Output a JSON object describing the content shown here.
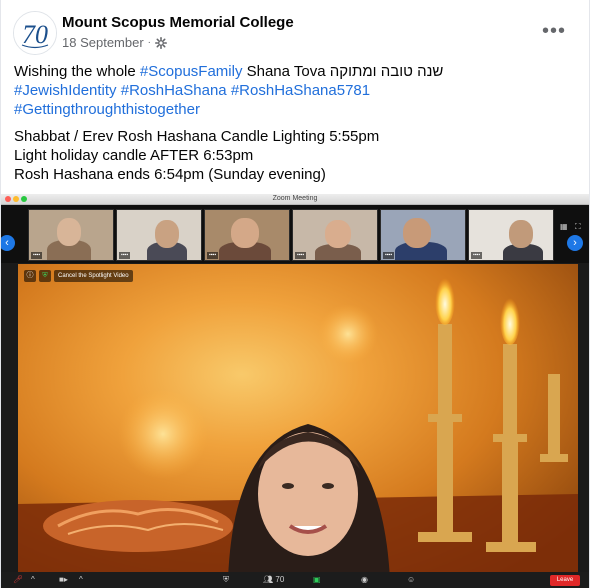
{
  "post": {
    "page_name": "Mount Scopus Memorial College",
    "date": "18 September",
    "dot": "·",
    "more_icon": "more-horizontal-icon",
    "privacy_icon": "gear-icon",
    "avatar_logo_text": "70",
    "text": {
      "line1_prefix": "Wishing the whole ",
      "line1_hashtag": "#ScopusFamily",
      "line1_suffix": " Shana Tova שנה טובה ומתוקה",
      "hashtags": [
        "#JewishIdentity",
        "#RoshHaShana",
        "#RoshHaShana5781"
      ],
      "line3_hashtag": "#Gettingthroughthistogether",
      "line4": "Shabbat / Erev Rosh Hashana Candle Lighting 5:55pm",
      "line5": "Light holiday candle AFTER 6:53pm",
      "line6": "Rosh Hashana ends 6:54pm (Sunday evening)"
    }
  },
  "zoom": {
    "window_title": "Zoom Meeting",
    "cancel_spotlight": "Cancel the Spotlight Video",
    "participants_count": "70",
    "leave": "Leave",
    "colors": {
      "traffic_red": "#fe5f57",
      "traffic_yellow": "#febc2e",
      "traffic_green": "#28c840",
      "arrow_blue": "#1e78e6",
      "leave_red": "#e02828"
    }
  }
}
